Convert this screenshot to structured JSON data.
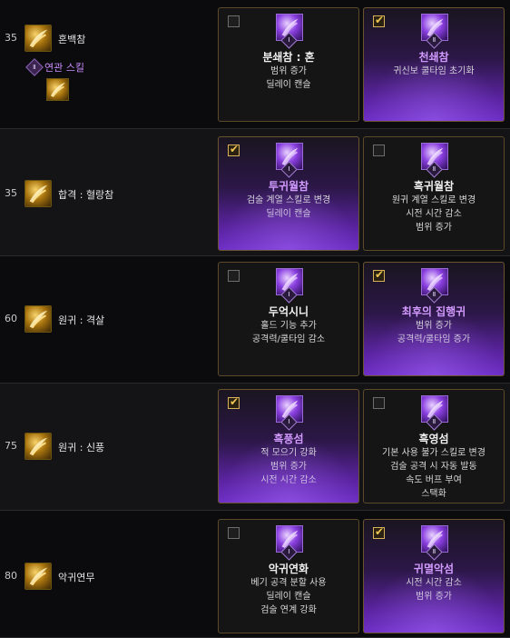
{
  "related_label": "연관 스킬",
  "rows": [
    {
      "level": "35",
      "skill": "혼백참",
      "has_related": true,
      "cards": [
        {
          "checked": false,
          "tier": "Ⅰ",
          "title": "분쇄참 : 혼",
          "lines": [
            "범위 증가",
            "딜레이 캔슬"
          ]
        },
        {
          "checked": true,
          "tier": "Ⅱ",
          "title": "천쇄참",
          "lines": [
            "귀신보 쿨타임 초기화"
          ]
        }
      ]
    },
    {
      "level": "35",
      "skill": "합격 : 혈랑참",
      "cards": [
        {
          "checked": true,
          "tier": "Ⅰ",
          "title": "투귀월참",
          "lines": [
            "검술 계열 스킬로 변경",
            "딜레이 캔슬"
          ]
        },
        {
          "checked": false,
          "tier": "Ⅱ",
          "title": "흑귀월참",
          "lines": [
            "원귀 계열 스킬로 변경",
            "시전 시간 감소",
            "범위 증가"
          ]
        }
      ]
    },
    {
      "level": "60",
      "skill": "원귀 : 격살",
      "cards": [
        {
          "checked": false,
          "tier": "Ⅰ",
          "title": "두억시니",
          "lines": [
            "홀드 기능 추가",
            "공격력/쿨타임 감소"
          ]
        },
        {
          "checked": true,
          "tier": "Ⅱ",
          "title": "최후의 집행귀",
          "lines": [
            "범위 증가",
            "공격력/쿨타임 증가"
          ]
        }
      ]
    },
    {
      "level": "75",
      "skill": "원귀 : 신풍",
      "cards": [
        {
          "checked": true,
          "tier": "Ⅰ",
          "title": "흑풍섬",
          "lines": [
            "적 모으기 강화",
            "범위 증가",
            "시전 시간 감소"
          ]
        },
        {
          "checked": false,
          "tier": "Ⅱ",
          "title": "흑영섬",
          "lines": [
            "기본 사용 불가 스킬로 변경",
            "검술 공격 시 자동 발동",
            "속도 버프 부여",
            "스택화"
          ]
        }
      ]
    },
    {
      "level": "80",
      "skill": "악귀연무",
      "cards": [
        {
          "checked": false,
          "tier": "Ⅰ",
          "title": "악귀연화",
          "lines": [
            "베기 공격 분할 사용",
            "딜레이 캔슬",
            "검술 연계 강화"
          ]
        },
        {
          "checked": true,
          "tier": "Ⅱ",
          "title": "귀멸악섬",
          "lines": [
            "시전 시간 감소",
            "범위 증가"
          ]
        }
      ]
    }
  ],
  "icons": {
    "skill": "gold-slash-icon",
    "card": "purple-slash-icon",
    "checkbox": "checkbox-icon"
  }
}
